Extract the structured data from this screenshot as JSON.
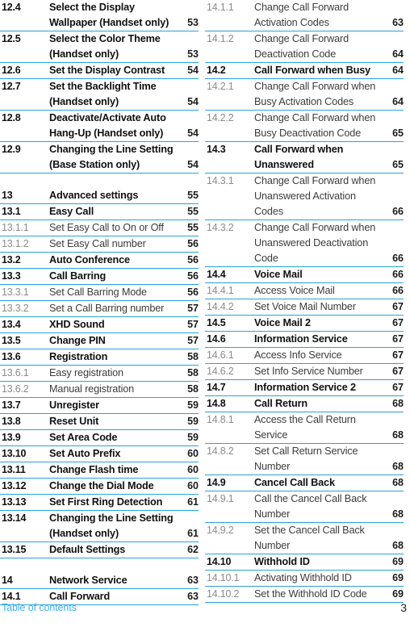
{
  "document": {
    "footer_label": "Table of contents",
    "page_number": "3",
    "accent_rule_color": "#29a3dc",
    "footer_label_color": "#3fb3ef",
    "subsection_number_color": "#8c8c8c",
    "section_text_color": "#111111"
  },
  "columns": [
    {
      "name": "left-column",
      "entries": [
        {
          "number": "12.4",
          "lines": [
            "Select the Display",
            "Wallpaper (Handset only)"
          ],
          "page": "53",
          "level": "section",
          "page_on_line": 1,
          "gap_before": false
        },
        {
          "number": "12.5",
          "lines": [
            "Select the Color Theme",
            "(Handset only)"
          ],
          "page": "53",
          "level": "section",
          "page_on_line": 1,
          "gap_before": false
        },
        {
          "number": "12.6",
          "lines": [
            "Set the Display Contrast"
          ],
          "page": "54",
          "level": "section",
          "page_on_line": 0,
          "gap_before": false
        },
        {
          "number": "12.7",
          "lines": [
            "Set the Backlight Time",
            "(Handset only)"
          ],
          "page": "54",
          "level": "section",
          "page_on_line": 1,
          "gap_before": false
        },
        {
          "number": "12.8",
          "lines": [
            "Deactivate/Activate Auto",
            "Hang-Up (Handset only)"
          ],
          "page": "54",
          "level": "section",
          "page_on_line": 1,
          "gap_before": false
        },
        {
          "number": "12.9",
          "lines": [
            "Changing the Line Setting",
            "(Base Station only)"
          ],
          "page": "54",
          "level": "section",
          "page_on_line": 1,
          "gap_before": false
        },
        {
          "number": "13",
          "lines": [
            "Advanced settings"
          ],
          "page": "55",
          "level": "section",
          "page_on_line": 0,
          "gap_before": true
        },
        {
          "number": "13.1",
          "lines": [
            "Easy Call"
          ],
          "page": "55",
          "level": "section",
          "page_on_line": 0,
          "gap_before": false
        },
        {
          "number": "13.1.1",
          "lines": [
            "Set Easy Call to On or Off"
          ],
          "page": "55",
          "level": "subsection",
          "page_on_line": 0,
          "gap_before": false
        },
        {
          "number": "13.1.2",
          "lines": [
            "Set Easy Call number"
          ],
          "page": "56",
          "level": "subsection",
          "page_on_line": 0,
          "gap_before": false
        },
        {
          "number": "13.2",
          "lines": [
            "Auto Conference"
          ],
          "page": "56",
          "level": "section",
          "page_on_line": 0,
          "gap_before": false
        },
        {
          "number": "13.3",
          "lines": [
            "Call Barring"
          ],
          "page": "56",
          "level": "section",
          "page_on_line": 0,
          "gap_before": false
        },
        {
          "number": "13.3.1",
          "lines": [
            "Set Call Barring Mode"
          ],
          "page": "56",
          "level": "subsection",
          "page_on_line": 0,
          "gap_before": false
        },
        {
          "number": "13.3.2",
          "lines": [
            "Set a Call Barring number"
          ],
          "page": "57",
          "level": "subsection",
          "page_on_line": 0,
          "gap_before": false
        },
        {
          "number": "13.4",
          "lines": [
            "XHD Sound"
          ],
          "page": "57",
          "level": "section",
          "page_on_line": 0,
          "gap_before": false
        },
        {
          "number": "13.5",
          "lines": [
            "Change PIN"
          ],
          "page": "57",
          "level": "section",
          "page_on_line": 0,
          "gap_before": false
        },
        {
          "number": "13.6",
          "lines": [
            "Registration"
          ],
          "page": "58",
          "level": "section",
          "page_on_line": 0,
          "gap_before": false
        },
        {
          "number": "13.6.1",
          "lines": [
            "Easy registration"
          ],
          "page": "58",
          "level": "subsection",
          "page_on_line": 0,
          "gap_before": false
        },
        {
          "number": "13.6.2",
          "lines": [
            "Manual registration"
          ],
          "page": "58",
          "level": "subsection",
          "page_on_line": 0,
          "gap_before": false
        },
        {
          "number": "13.7",
          "lines": [
            "Unregister"
          ],
          "page": "59",
          "level": "section",
          "page_on_line": 0,
          "gap_before": false
        },
        {
          "number": "13.8",
          "lines": [
            "Reset Unit"
          ],
          "page": "59",
          "level": "section",
          "page_on_line": 0,
          "gap_before": false
        },
        {
          "number": "13.9",
          "lines": [
            "Set Area Code"
          ],
          "page": "59",
          "level": "section",
          "page_on_line": 0,
          "gap_before": false
        },
        {
          "number": "13.10",
          "lines": [
            "Set Auto Prefix"
          ],
          "page": "60",
          "level": "section",
          "page_on_line": 0,
          "gap_before": false
        },
        {
          "number": "13.11",
          "lines": [
            "Change Flash time"
          ],
          "page": "60",
          "level": "section",
          "page_on_line": 0,
          "gap_before": false
        },
        {
          "number": "13.12",
          "lines": [
            "Change the Dial Mode"
          ],
          "page": "60",
          "level": "section",
          "page_on_line": 0,
          "gap_before": false
        },
        {
          "number": "13.13",
          "lines": [
            "Set First Ring Detection"
          ],
          "page": "61",
          "level": "section",
          "page_on_line": 0,
          "gap_before": false
        },
        {
          "number": "13.14",
          "lines": [
            "Changing the Line Setting",
            "(Handset only)"
          ],
          "page": "61",
          "level": "section",
          "page_on_line": 1,
          "gap_before": false
        },
        {
          "number": "13.15",
          "lines": [
            "Default Settings"
          ],
          "page": "62",
          "level": "section",
          "page_on_line": 0,
          "gap_before": false
        },
        {
          "number": "14",
          "lines": [
            "Network Service"
          ],
          "page": "63",
          "level": "section",
          "page_on_line": 0,
          "gap_before": true
        },
        {
          "number": "14.1",
          "lines": [
            "Call Forward"
          ],
          "page": "63",
          "level": "section",
          "page_on_line": 0,
          "gap_before": false
        }
      ]
    },
    {
      "name": "right-column",
      "entries": [
        {
          "number": "14.1.1",
          "lines": [
            "Change Call Forward",
            "Activation Codes"
          ],
          "page": "63",
          "level": "subsection",
          "page_on_line": 1,
          "gap_before": false
        },
        {
          "number": "14.1.2",
          "lines": [
            "Change Call Forward",
            "Deactivation Code"
          ],
          "page": "64",
          "level": "subsection",
          "page_on_line": 1,
          "gap_before": false
        },
        {
          "number": "14.2",
          "lines": [
            "Call Forward when Busy"
          ],
          "page": "64",
          "level": "section",
          "page_on_line": 0,
          "gap_before": false
        },
        {
          "number": "14.2.1",
          "lines": [
            "Change Call Forward when",
            "Busy Activation Codes"
          ],
          "page": "64",
          "level": "subsection",
          "page_on_line": 1,
          "gap_before": false
        },
        {
          "number": "14.2.2",
          "lines": [
            "Change Call Forward when",
            "Busy Deactivation Code"
          ],
          "page": "65",
          "level": "subsection",
          "page_on_line": 1,
          "gap_before": false
        },
        {
          "number": "14.3",
          "lines": [
            "Call Forward when",
            "Unanswered"
          ],
          "page": "65",
          "level": "section",
          "page_on_line": 1,
          "gap_before": false
        },
        {
          "number": "14.3.1",
          "lines": [
            "Change Call Forward when",
            "Unanswered Activation",
            "Codes"
          ],
          "page": "66",
          "level": "subsection",
          "page_on_line": 2,
          "gap_before": false
        },
        {
          "number": "14.3.2",
          "lines": [
            "Change Call Forward when",
            "Unanswered Deactivation",
            "Code"
          ],
          "page": "66",
          "level": "subsection",
          "page_on_line": 2,
          "gap_before": false
        },
        {
          "number": "14.4",
          "lines": [
            "Voice Mail"
          ],
          "page": "66",
          "level": "section",
          "page_on_line": 0,
          "gap_before": false
        },
        {
          "number": "14.4.1",
          "lines": [
            "Access Voice Mail"
          ],
          "page": "66",
          "level": "subsection",
          "page_on_line": 0,
          "gap_before": false
        },
        {
          "number": "14.4.2",
          "lines": [
            "Set Voice Mail Number"
          ],
          "page": "67",
          "level": "subsection",
          "page_on_line": 0,
          "gap_before": false
        },
        {
          "number": "14.5",
          "lines": [
            "Voice Mail 2"
          ],
          "page": "67",
          "level": "section",
          "page_on_line": 0,
          "gap_before": false
        },
        {
          "number": "14.6",
          "lines": [
            "Information Service"
          ],
          "page": "67",
          "level": "section",
          "page_on_line": 0,
          "gap_before": false
        },
        {
          "number": "14.6.1",
          "lines": [
            "Access Info Service"
          ],
          "page": "67",
          "level": "subsection",
          "page_on_line": 0,
          "gap_before": false
        },
        {
          "number": "14.6.2",
          "lines": [
            "Set Info Service Number"
          ],
          "page": "67",
          "level": "subsection",
          "page_on_line": 0,
          "gap_before": false
        },
        {
          "number": "14.7",
          "lines": [
            "Information Service 2"
          ],
          "page": "67",
          "level": "section",
          "page_on_line": 0,
          "gap_before": false
        },
        {
          "number": "14.8",
          "lines": [
            "Call Return"
          ],
          "page": "68",
          "level": "section",
          "page_on_line": 0,
          "gap_before": false
        },
        {
          "number": "14.8.1",
          "lines": [
            "Access the Call Return",
            "Service"
          ],
          "page": "68",
          "level": "subsection",
          "page_on_line": 1,
          "gap_before": false
        },
        {
          "number": "14.8.2",
          "lines": [
            "Set Call Return Service",
            "Number"
          ],
          "page": "68",
          "level": "subsection",
          "page_on_line": 1,
          "gap_before": false
        },
        {
          "number": "14.9",
          "lines": [
            "Cancel Call Back"
          ],
          "page": "68",
          "level": "section",
          "page_on_line": 0,
          "gap_before": false
        },
        {
          "number": "14.9.1",
          "lines": [
            "Call the Cancel Call Back",
            "Number"
          ],
          "page": "68",
          "level": "subsection",
          "page_on_line": 1,
          "gap_before": false
        },
        {
          "number": "14.9.2",
          "lines": [
            "Set the Cancel Call Back",
            "Number"
          ],
          "page": "68",
          "level": "subsection",
          "page_on_line": 1,
          "gap_before": false
        },
        {
          "number": "14.10",
          "lines": [
            "Withhold ID"
          ],
          "page": "69",
          "level": "section",
          "page_on_line": 0,
          "gap_before": false
        },
        {
          "number": "14.10.1",
          "lines": [
            "Activating Withhold ID"
          ],
          "page": "69",
          "level": "subsection",
          "page_on_line": 0,
          "gap_before": false
        },
        {
          "number": "14.10.2",
          "lines": [
            "Set the Withhold ID Code"
          ],
          "page": "69",
          "level": "subsection",
          "page_on_line": 0,
          "gap_before": false
        }
      ]
    }
  ]
}
